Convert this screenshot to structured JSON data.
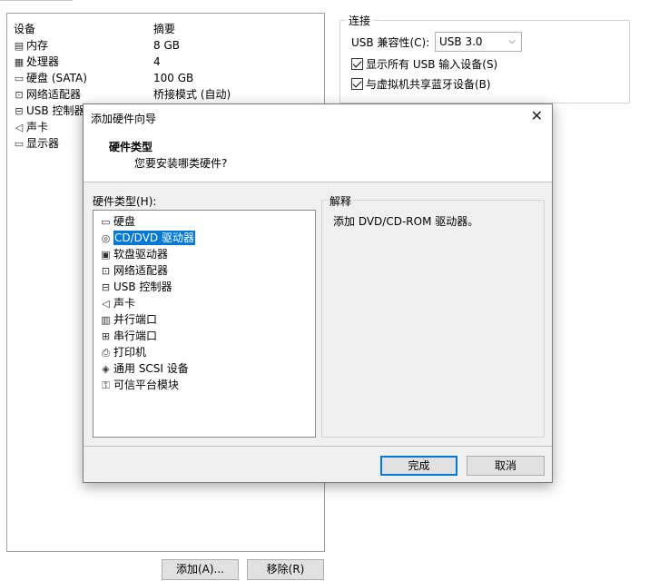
{
  "device_list": {
    "header_device": "设备",
    "header_summary": "摘要",
    "items": [
      {
        "icon": "memory-icon",
        "glyph": "▤",
        "name": "内存",
        "summary": "8 GB"
      },
      {
        "icon": "processor-icon",
        "glyph": "▦",
        "name": "处理器",
        "summary": "4"
      },
      {
        "icon": "hard-disk-icon",
        "glyph": "▭",
        "name": "硬盘 (SATA)",
        "summary": "100 GB"
      },
      {
        "icon": "network-adapter-icon",
        "glyph": "⊡",
        "name": "网络适配器",
        "summary": "桥接模式 (自动)"
      },
      {
        "icon": "usb-controller-icon",
        "glyph": "⊟",
        "name": "USB 控制器",
        "summary": ""
      },
      {
        "icon": "sound-card-icon",
        "glyph": "◁",
        "name": "声卡",
        "summary": ""
      },
      {
        "icon": "display-icon",
        "glyph": "▭",
        "name": "显示器",
        "summary": ""
      }
    ]
  },
  "buttons": {
    "add": "添加(A)...",
    "remove": "移除(R)"
  },
  "connection": {
    "legend": "连接",
    "usb_compat_label": "USB 兼容性(C):",
    "usb_compat_value": "USB 3.0",
    "show_all_usb": "显示所有 USB 输入设备(S)",
    "share_bluetooth": "与虚拟机共享蓝牙设备(B)"
  },
  "dialog": {
    "title": "添加硬件向导",
    "close_glyph": "✕",
    "header_title": "硬件类型",
    "header_subtitle": "您要安装哪类硬件?",
    "list_label": "硬件类型(H):",
    "hardware_types": [
      {
        "icon": "hard-disk-icon",
        "glyph": "▭",
        "label": "硬盘"
      },
      {
        "icon": "cd-dvd-icon",
        "glyph": "◎",
        "label": "CD/DVD 驱动器"
      },
      {
        "icon": "floppy-icon",
        "glyph": "▣",
        "label": "软盘驱动器"
      },
      {
        "icon": "network-adapter-icon",
        "glyph": "⊡",
        "label": "网络适配器"
      },
      {
        "icon": "usb-controller-icon",
        "glyph": "⊟",
        "label": "USB 控制器"
      },
      {
        "icon": "sound-card-icon",
        "glyph": "◁",
        "label": "声卡"
      },
      {
        "icon": "parallel-port-icon",
        "glyph": "▥",
        "label": "并行端口"
      },
      {
        "icon": "serial-port-icon",
        "glyph": "⊞",
        "label": "串行端口"
      },
      {
        "icon": "printer-icon",
        "glyph": "⎙",
        "label": "打印机"
      },
      {
        "icon": "scsi-device-icon",
        "glyph": "◈",
        "label": "通用 SCSI 设备"
      },
      {
        "icon": "tpm-icon",
        "glyph": "⚿",
        "label": "可信平台模块"
      }
    ],
    "selected_index": 1,
    "explanation_legend": "解释",
    "explanation_text": "添加 DVD/CD-ROM 驱动器。",
    "finish": "完成",
    "cancel": "取消"
  }
}
